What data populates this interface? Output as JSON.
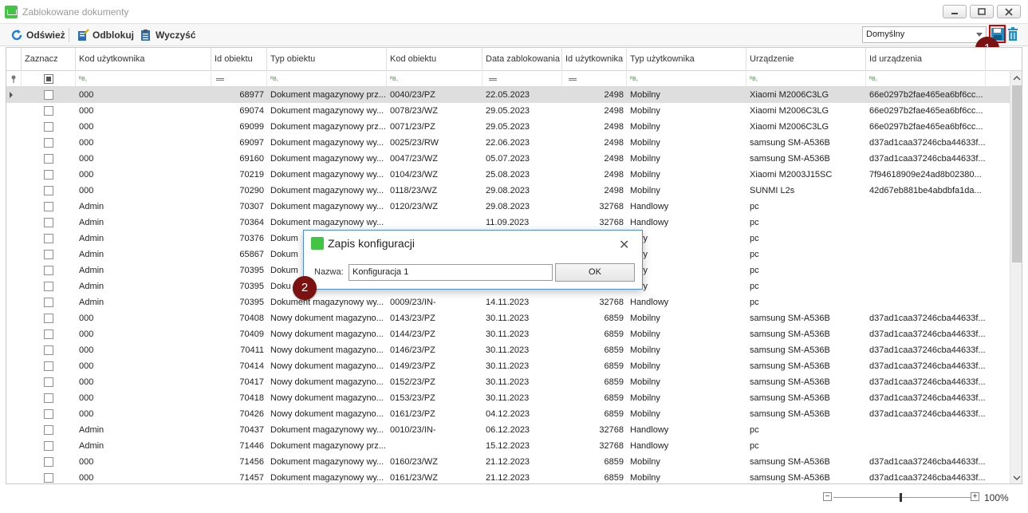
{
  "window": {
    "title": "Zablokowane dokumenty"
  },
  "toolbar": {
    "refresh_label": "Odśwież",
    "unlock_label": "Odblokuj",
    "clear_label": "Wyczyść",
    "config_value": "Domyślny"
  },
  "badges": {
    "one": "1",
    "two": "2"
  },
  "grid": {
    "columns": [
      "Zaznacz",
      "Kod użytkownika",
      "Id obiektu",
      "Typ obiektu",
      "Kod obiektu",
      "Data zablokowania",
      "Id użytkownika",
      "Typ użytkownika",
      "Urządzenie",
      "Id urządzenia"
    ],
    "rows": [
      {
        "user": "000",
        "id": "68977",
        "type": "Dokument magazynowy prz...",
        "code": "0040/23/PZ",
        "date": "22.05.2023",
        "uid": "2498",
        "utype": "Mobilny",
        "device": "Xiaomi M2006C3LG",
        "devid": "66e0297b2fae465ea6bf6cc..."
      },
      {
        "user": "000",
        "id": "69074",
        "type": "Dokument magazynowy wy...",
        "code": "0078/23/WZ",
        "date": "29.05.2023",
        "uid": "2498",
        "utype": "Mobilny",
        "device": "Xiaomi M2006C3LG",
        "devid": "66e0297b2fae465ea6bf6cc..."
      },
      {
        "user": "000",
        "id": "69099",
        "type": "Dokument magazynowy prz...",
        "code": "0071/23/PZ",
        "date": "29.05.2023",
        "uid": "2498",
        "utype": "Mobilny",
        "device": "Xiaomi M2006C3LG",
        "devid": "66e0297b2fae465ea6bf6cc..."
      },
      {
        "user": "000",
        "id": "69097",
        "type": "Dokument magazynowy wy...",
        "code": "0025/23/RW",
        "date": "22.06.2023",
        "uid": "2498",
        "utype": "Mobilny",
        "device": "samsung SM-A536B",
        "devid": "d37ad1caa37246cba44633f..."
      },
      {
        "user": "000",
        "id": "69160",
        "type": "Dokument magazynowy wy...",
        "code": "0047/23/WZ",
        "date": "05.07.2023",
        "uid": "2498",
        "utype": "Mobilny",
        "device": "samsung SM-A536B",
        "devid": "d37ad1caa37246cba44633f..."
      },
      {
        "user": "000",
        "id": "70219",
        "type": "Dokument magazynowy wy...",
        "code": "0104/23/WZ",
        "date": "25.08.2023",
        "uid": "2498",
        "utype": "Mobilny",
        "device": "Xiaomi M2003J15SC",
        "devid": "7f94618909e24ad8b02380..."
      },
      {
        "user": "000",
        "id": "70290",
        "type": "Dokument magazynowy wy...",
        "code": "0118/23/WZ",
        "date": "29.08.2023",
        "uid": "2498",
        "utype": "Mobilny",
        "device": "SUNMI L2s",
        "devid": "42d67eb881be4abdbfa1da..."
      },
      {
        "user": "Admin",
        "id": "70307",
        "type": "Dokument magazynowy wy...",
        "code": "0120/23/WZ",
        "date": "29.08.2023",
        "uid": "32768",
        "utype": "Handlowy",
        "device": "pc",
        "devid": ""
      },
      {
        "user": "Admin",
        "id": "70364",
        "type": "Dokument magazynowy wy...",
        "code": "",
        "date": "11.09.2023",
        "uid": "32768",
        "utype": "Handlowy",
        "device": "pc",
        "devid": ""
      },
      {
        "user": "Admin",
        "id": "70376",
        "type": "Dokum",
        "code": "",
        "date": "",
        "uid": "",
        "utype": "lowy",
        "device": "pc",
        "devid": ""
      },
      {
        "user": "Admin",
        "id": "65867",
        "type": "Dokum",
        "code": "",
        "date": "",
        "uid": "",
        "utype": "lowy",
        "device": "pc",
        "devid": ""
      },
      {
        "user": "Admin",
        "id": "70395",
        "type": "Dokum",
        "code": "",
        "date": "",
        "uid": "",
        "utype": "lowy",
        "device": "pc",
        "devid": ""
      },
      {
        "user": "Admin",
        "id": "70395",
        "type": "Doku",
        "code": "",
        "date": "",
        "uid": "",
        "utype": "lowy",
        "device": "pc",
        "devid": ""
      },
      {
        "user": "Admin",
        "id": "70395",
        "type": "Dokument magazynowy wy...",
        "code": "0009/23/IN-",
        "date": "14.11.2023",
        "uid": "32768",
        "utype": "Handlowy",
        "device": "pc",
        "devid": ""
      },
      {
        "user": "000",
        "id": "70408",
        "type": "Nowy dokument magazyno...",
        "code": "0143/23/PZ",
        "date": "30.11.2023",
        "uid": "6859",
        "utype": "Mobilny",
        "device": "samsung SM-A536B",
        "devid": "d37ad1caa37246cba44633f..."
      },
      {
        "user": "000",
        "id": "70409",
        "type": "Nowy dokument magazyno...",
        "code": "0144/23/PZ",
        "date": "30.11.2023",
        "uid": "6859",
        "utype": "Mobilny",
        "device": "samsung SM-A536B",
        "devid": "d37ad1caa37246cba44633f..."
      },
      {
        "user": "000",
        "id": "70411",
        "type": "Nowy dokument magazyno...",
        "code": "0146/23/PZ",
        "date": "30.11.2023",
        "uid": "6859",
        "utype": "Mobilny",
        "device": "samsung SM-A536B",
        "devid": "d37ad1caa37246cba44633f..."
      },
      {
        "user": "000",
        "id": "70414",
        "type": "Nowy dokument magazyno...",
        "code": "0149/23/PZ",
        "date": "30.11.2023",
        "uid": "6859",
        "utype": "Mobilny",
        "device": "samsung SM-A536B",
        "devid": "d37ad1caa37246cba44633f..."
      },
      {
        "user": "000",
        "id": "70417",
        "type": "Nowy dokument magazyno...",
        "code": "0152/23/PZ",
        "date": "30.11.2023",
        "uid": "6859",
        "utype": "Mobilny",
        "device": "samsung SM-A536B",
        "devid": "d37ad1caa37246cba44633f..."
      },
      {
        "user": "000",
        "id": "70418",
        "type": "Nowy dokument magazyno...",
        "code": "0153/23/PZ",
        "date": "30.11.2023",
        "uid": "6859",
        "utype": "Mobilny",
        "device": "samsung SM-A536B",
        "devid": "d37ad1caa37246cba44633f..."
      },
      {
        "user": "000",
        "id": "70426",
        "type": "Nowy dokument magazyno...",
        "code": "0161/23/PZ",
        "date": "04.12.2023",
        "uid": "6859",
        "utype": "Mobilny",
        "device": "samsung SM-A536B",
        "devid": "d37ad1caa37246cba44633f..."
      },
      {
        "user": "Admin",
        "id": "70437",
        "type": "Dokument magazynowy wy...",
        "code": "0010/23/IN-",
        "date": "06.12.2023",
        "uid": "32768",
        "utype": "Handlowy",
        "device": "pc",
        "devid": ""
      },
      {
        "user": "Admin",
        "id": "71446",
        "type": "Dokument magazynowy prz...",
        "code": "",
        "date": "15.12.2023",
        "uid": "32768",
        "utype": "Handlowy",
        "device": "pc",
        "devid": ""
      },
      {
        "user": "000",
        "id": "71456",
        "type": "Dokument magazynowy wy...",
        "code": "0160/23/WZ",
        "date": "21.12.2023",
        "uid": "6859",
        "utype": "Mobilny",
        "device": "samsung SM-A536B",
        "devid": "d37ad1caa37246cba44633f..."
      },
      {
        "user": "000",
        "id": "71457",
        "type": "Dokument magazynowy wy...",
        "code": "0161/23/WZ",
        "date": "21.12.2023",
        "uid": "6859",
        "utype": "Mobilny",
        "device": "samsung SM-A536B",
        "devid": "d37ad1caa37246cba44633f..."
      }
    ]
  },
  "dialog": {
    "title": "Zapis konfiguracji",
    "label": "Nazwa:",
    "value": "Konfiguracja 1",
    "ok": "OK"
  },
  "status": {
    "zoom": "100%",
    "minus": "−",
    "plus": "+"
  }
}
